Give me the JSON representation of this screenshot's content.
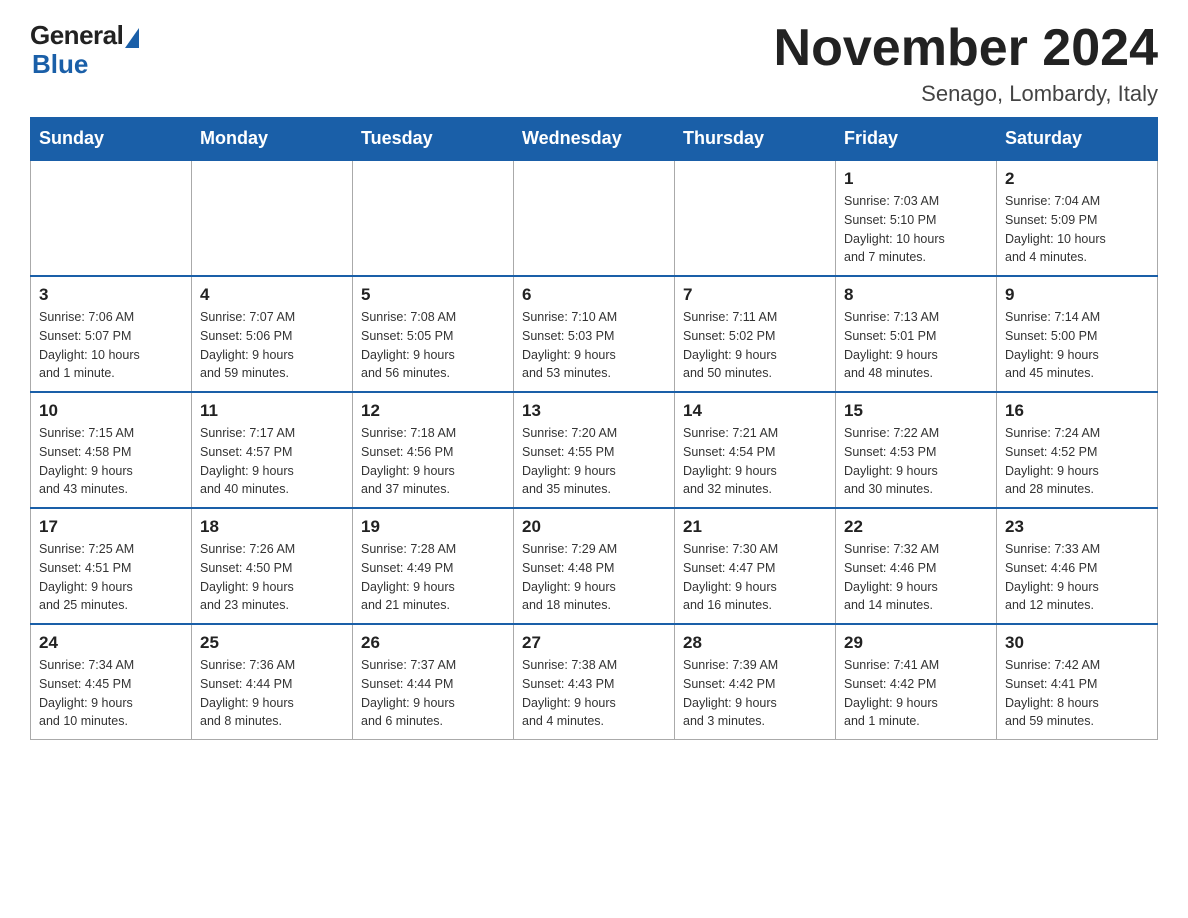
{
  "header": {
    "logo": {
      "general": "General",
      "blue": "Blue"
    },
    "title": "November 2024",
    "location": "Senago, Lombardy, Italy"
  },
  "weekdays": [
    "Sunday",
    "Monday",
    "Tuesday",
    "Wednesday",
    "Thursday",
    "Friday",
    "Saturday"
  ],
  "weeks": [
    [
      {
        "day": null,
        "info": null
      },
      {
        "day": null,
        "info": null
      },
      {
        "day": null,
        "info": null
      },
      {
        "day": null,
        "info": null
      },
      {
        "day": null,
        "info": null
      },
      {
        "day": "1",
        "info": "Sunrise: 7:03 AM\nSunset: 5:10 PM\nDaylight: 10 hours\nand 7 minutes."
      },
      {
        "day": "2",
        "info": "Sunrise: 7:04 AM\nSunset: 5:09 PM\nDaylight: 10 hours\nand 4 minutes."
      }
    ],
    [
      {
        "day": "3",
        "info": "Sunrise: 7:06 AM\nSunset: 5:07 PM\nDaylight: 10 hours\nand 1 minute."
      },
      {
        "day": "4",
        "info": "Sunrise: 7:07 AM\nSunset: 5:06 PM\nDaylight: 9 hours\nand 59 minutes."
      },
      {
        "day": "5",
        "info": "Sunrise: 7:08 AM\nSunset: 5:05 PM\nDaylight: 9 hours\nand 56 minutes."
      },
      {
        "day": "6",
        "info": "Sunrise: 7:10 AM\nSunset: 5:03 PM\nDaylight: 9 hours\nand 53 minutes."
      },
      {
        "day": "7",
        "info": "Sunrise: 7:11 AM\nSunset: 5:02 PM\nDaylight: 9 hours\nand 50 minutes."
      },
      {
        "day": "8",
        "info": "Sunrise: 7:13 AM\nSunset: 5:01 PM\nDaylight: 9 hours\nand 48 minutes."
      },
      {
        "day": "9",
        "info": "Sunrise: 7:14 AM\nSunset: 5:00 PM\nDaylight: 9 hours\nand 45 minutes."
      }
    ],
    [
      {
        "day": "10",
        "info": "Sunrise: 7:15 AM\nSunset: 4:58 PM\nDaylight: 9 hours\nand 43 minutes."
      },
      {
        "day": "11",
        "info": "Sunrise: 7:17 AM\nSunset: 4:57 PM\nDaylight: 9 hours\nand 40 minutes."
      },
      {
        "day": "12",
        "info": "Sunrise: 7:18 AM\nSunset: 4:56 PM\nDaylight: 9 hours\nand 37 minutes."
      },
      {
        "day": "13",
        "info": "Sunrise: 7:20 AM\nSunset: 4:55 PM\nDaylight: 9 hours\nand 35 minutes."
      },
      {
        "day": "14",
        "info": "Sunrise: 7:21 AM\nSunset: 4:54 PM\nDaylight: 9 hours\nand 32 minutes."
      },
      {
        "day": "15",
        "info": "Sunrise: 7:22 AM\nSunset: 4:53 PM\nDaylight: 9 hours\nand 30 minutes."
      },
      {
        "day": "16",
        "info": "Sunrise: 7:24 AM\nSunset: 4:52 PM\nDaylight: 9 hours\nand 28 minutes."
      }
    ],
    [
      {
        "day": "17",
        "info": "Sunrise: 7:25 AM\nSunset: 4:51 PM\nDaylight: 9 hours\nand 25 minutes."
      },
      {
        "day": "18",
        "info": "Sunrise: 7:26 AM\nSunset: 4:50 PM\nDaylight: 9 hours\nand 23 minutes."
      },
      {
        "day": "19",
        "info": "Sunrise: 7:28 AM\nSunset: 4:49 PM\nDaylight: 9 hours\nand 21 minutes."
      },
      {
        "day": "20",
        "info": "Sunrise: 7:29 AM\nSunset: 4:48 PM\nDaylight: 9 hours\nand 18 minutes."
      },
      {
        "day": "21",
        "info": "Sunrise: 7:30 AM\nSunset: 4:47 PM\nDaylight: 9 hours\nand 16 minutes."
      },
      {
        "day": "22",
        "info": "Sunrise: 7:32 AM\nSunset: 4:46 PM\nDaylight: 9 hours\nand 14 minutes."
      },
      {
        "day": "23",
        "info": "Sunrise: 7:33 AM\nSunset: 4:46 PM\nDaylight: 9 hours\nand 12 minutes."
      }
    ],
    [
      {
        "day": "24",
        "info": "Sunrise: 7:34 AM\nSunset: 4:45 PM\nDaylight: 9 hours\nand 10 minutes."
      },
      {
        "day": "25",
        "info": "Sunrise: 7:36 AM\nSunset: 4:44 PM\nDaylight: 9 hours\nand 8 minutes."
      },
      {
        "day": "26",
        "info": "Sunrise: 7:37 AM\nSunset: 4:44 PM\nDaylight: 9 hours\nand 6 minutes."
      },
      {
        "day": "27",
        "info": "Sunrise: 7:38 AM\nSunset: 4:43 PM\nDaylight: 9 hours\nand 4 minutes."
      },
      {
        "day": "28",
        "info": "Sunrise: 7:39 AM\nSunset: 4:42 PM\nDaylight: 9 hours\nand 3 minutes."
      },
      {
        "day": "29",
        "info": "Sunrise: 7:41 AM\nSunset: 4:42 PM\nDaylight: 9 hours\nand 1 minute."
      },
      {
        "day": "30",
        "info": "Sunrise: 7:42 AM\nSunset: 4:41 PM\nDaylight: 8 hours\nand 59 minutes."
      }
    ]
  ]
}
